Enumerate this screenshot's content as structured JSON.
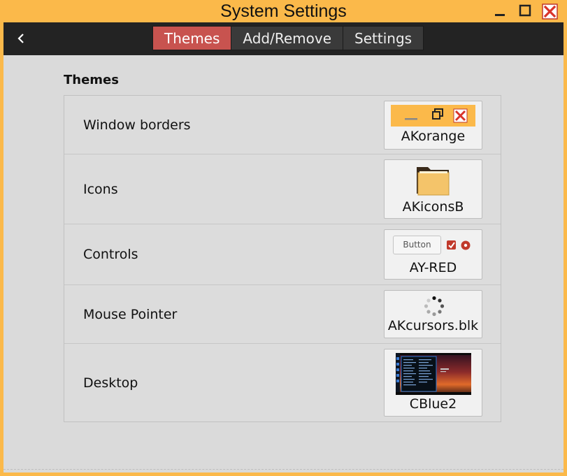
{
  "window": {
    "title": "System Settings"
  },
  "toolbar": {
    "tabs": [
      {
        "label": "Themes",
        "active": true
      },
      {
        "label": "Add/Remove",
        "active": false
      },
      {
        "label": "Settings",
        "active": false
      }
    ]
  },
  "themes": {
    "section_title": "Themes",
    "rows": [
      {
        "label": "Window borders",
        "theme": "AKorange",
        "preview_icon": "window-buttons-preview"
      },
      {
        "label": "Icons",
        "theme": "AKiconsB",
        "preview_icon": "folder-icon"
      },
      {
        "label": "Controls",
        "theme": "AY-RED",
        "preview_button_label": "Button"
      },
      {
        "label": "Mouse Pointer",
        "theme": "AKcursors.blk",
        "preview_icon": "spinner-icon"
      },
      {
        "label": "Desktop",
        "theme": "CBlue2",
        "preview_icon": "desktop-thumbnail"
      }
    ]
  },
  "colors": {
    "frame": "#fbb94a",
    "toolbar": "#232323",
    "active_tab": "#c8534f",
    "content_bg": "#dadada"
  }
}
